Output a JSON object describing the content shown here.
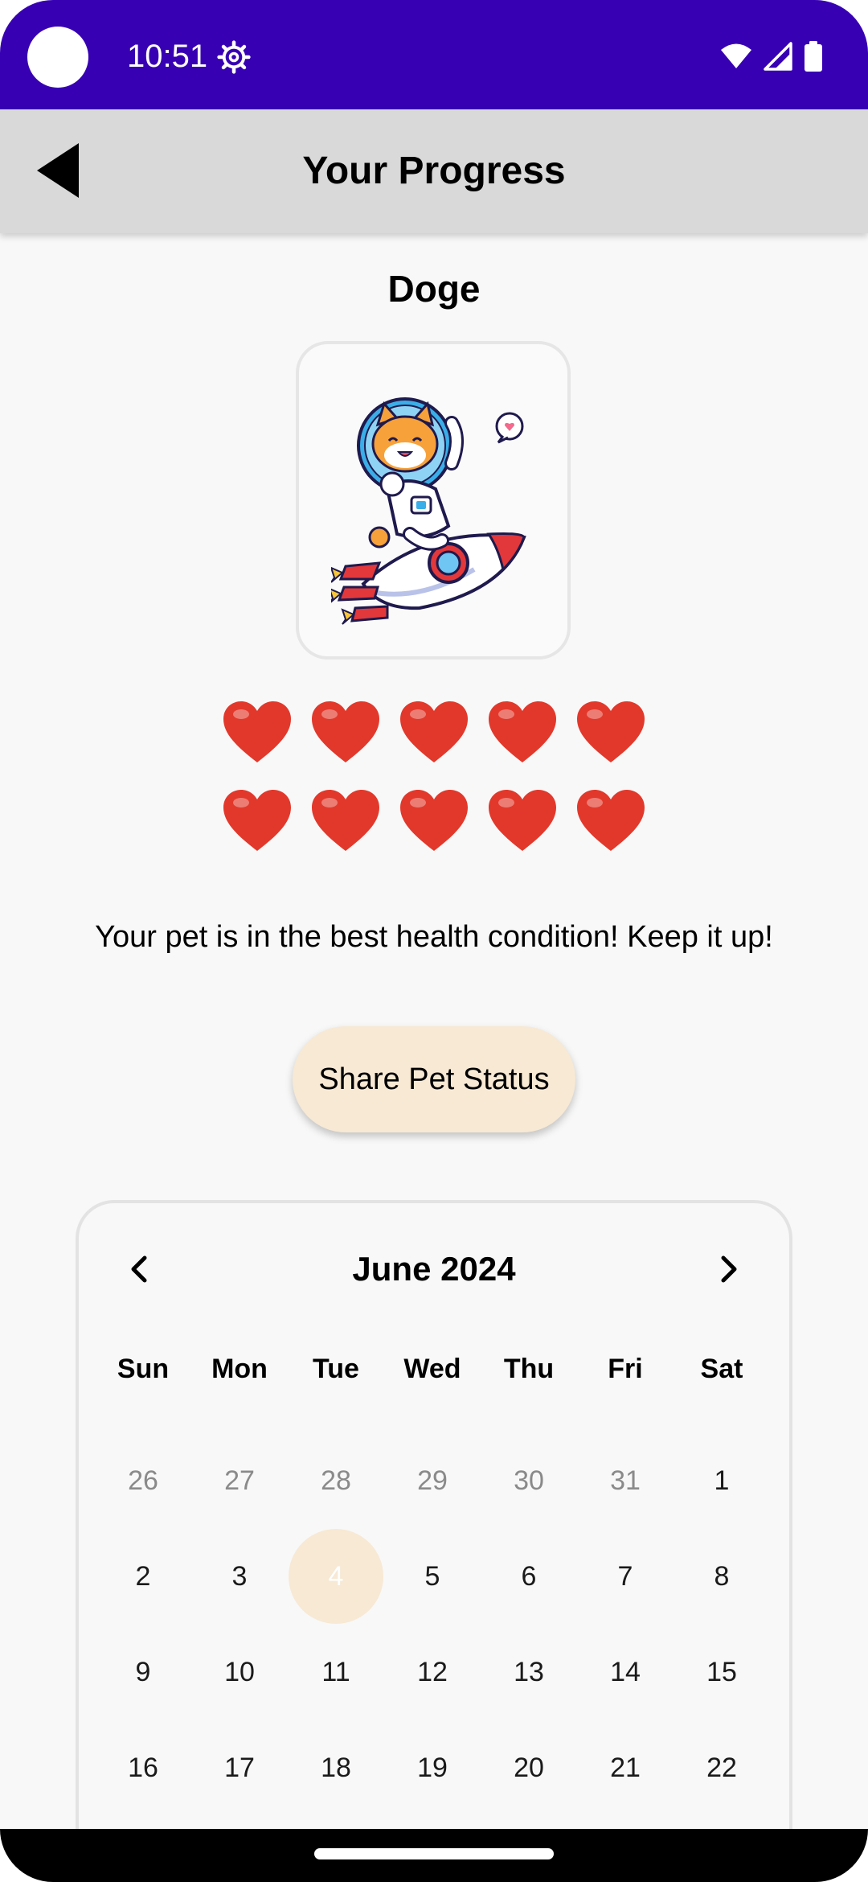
{
  "status_bar": {
    "time": "10:51",
    "icons": [
      "camera-cutout",
      "gear-icon",
      "wifi-icon",
      "signal-icon",
      "battery-icon"
    ],
    "color": "#3700b3"
  },
  "app_bar": {
    "title": "Your Progress",
    "back_icon": "back-triangle-icon"
  },
  "pet": {
    "name": "Doge",
    "image": "astronaut-cat-on-rocket-illustration"
  },
  "health": {
    "hearts_filled": 10,
    "hearts_total": 10,
    "heart_color": "#e2382b",
    "message": "Your pet is in the best health condition! Keep it up!"
  },
  "share_button": {
    "label": "Share Pet Status",
    "color": "#f7e9d4"
  },
  "calendar": {
    "month_label": "June 2024",
    "prev_icon": "chevron-left-icon",
    "next_icon": "chevron-right-icon",
    "weekdays": [
      "Sun",
      "Mon",
      "Tue",
      "Wed",
      "Thu",
      "Fri",
      "Sat"
    ],
    "weeks": [
      [
        "26",
        "27",
        "28",
        "29",
        "30",
        "31",
        "1"
      ],
      [
        "2",
        "3",
        "4",
        "5",
        "6",
        "7",
        "8"
      ],
      [
        "9",
        "10",
        "11",
        "12",
        "13",
        "14",
        "15"
      ],
      [
        "16",
        "17",
        "18",
        "19",
        "20",
        "21",
        "22"
      ]
    ],
    "muted_days_in_first_week": 6,
    "selected_day": "4",
    "selected_color": "#f7e9d4"
  }
}
